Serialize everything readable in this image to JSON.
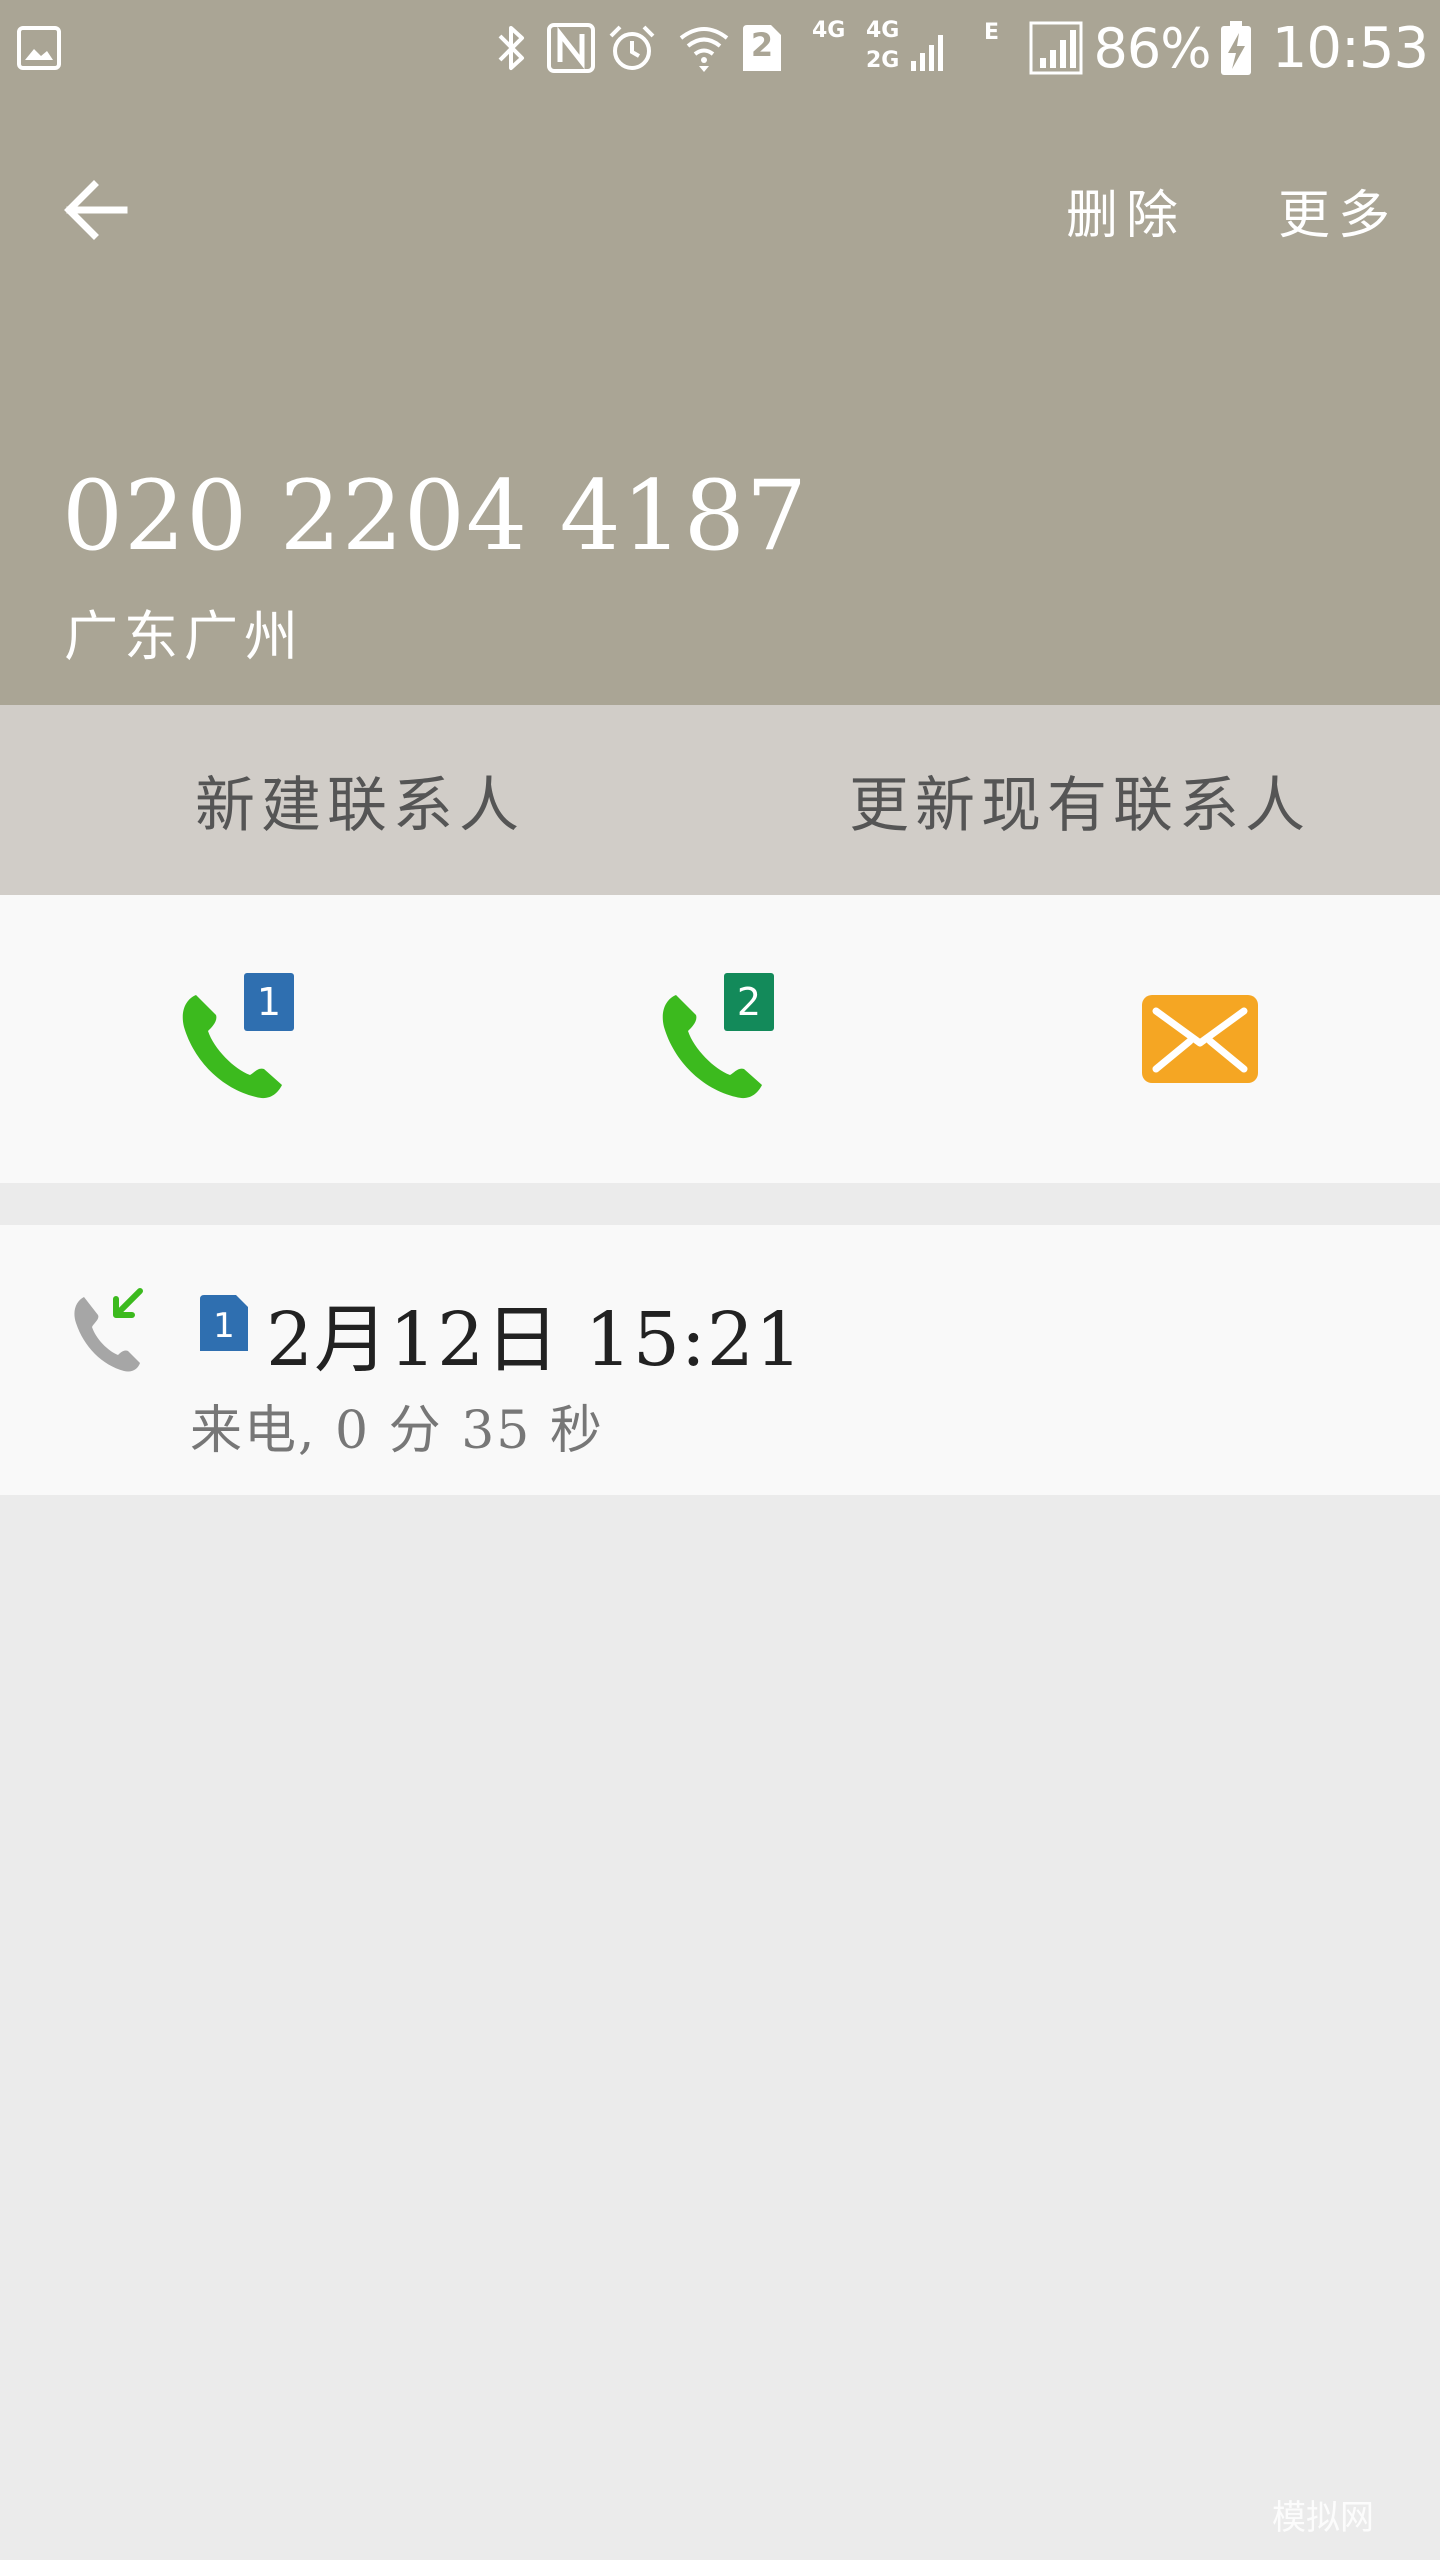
{
  "status_bar": {
    "battery_percent": "86%",
    "time": "10:53",
    "sim_slot_badge": "2",
    "network_labels": [
      "4G",
      "4G",
      "2G",
      "E"
    ],
    "icons": [
      "gallery-icon",
      "bluetooth-icon",
      "nfc-icon",
      "alarm-icon",
      "wifi-icon",
      "signal-icon",
      "battery-charging-icon"
    ]
  },
  "app_bar": {
    "back_icon": "arrow-left-icon",
    "delete_label": "删除",
    "more_label": "更多"
  },
  "caller": {
    "number": "020 2204 4187",
    "location": "广东广州"
  },
  "contact_actions": {
    "new_contact_label": "新建联系人",
    "update_contact_label": "更新现有联系人"
  },
  "quick_actions": [
    {
      "icon": "phone-icon",
      "sim": "1",
      "sim_color": "#2f6fb0"
    },
    {
      "icon": "phone-icon",
      "sim": "2",
      "sim_color": "#138a5a"
    },
    {
      "icon": "message-icon",
      "color": "#f5a623"
    }
  ],
  "call_log": {
    "entries": [
      {
        "type_icon": "incoming-call-icon",
        "sim": "1",
        "datetime": "2月12日  15:21",
        "detail": "来电, 0 分 35 秒"
      }
    ]
  },
  "watermark": "模拟网",
  "colors": {
    "header_bg": "#aaa595",
    "contact_bar_bg": "#d1cdc8",
    "call_green": "#3cba1e",
    "sim1_blue": "#2f6fb0",
    "sim2_green": "#138a5a",
    "message_orange": "#f5a623"
  }
}
